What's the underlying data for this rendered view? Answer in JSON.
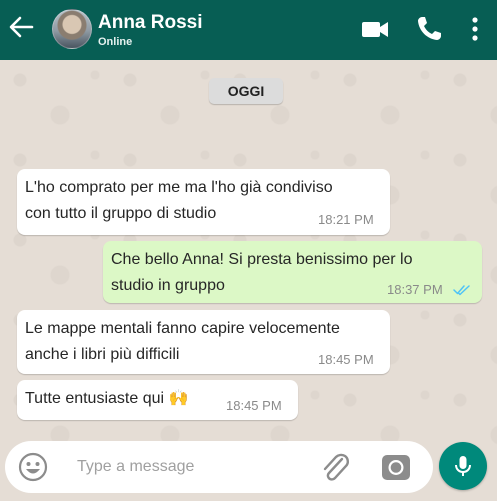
{
  "header": {
    "contact_name": "Anna Rossi",
    "status": "Online",
    "icons": [
      "back-arrow-icon",
      "video-call-icon",
      "phone-icon",
      "more-vertical-icon"
    ],
    "color": "#075e54"
  },
  "chat": {
    "date_label": "OGGI",
    "messages": [
      {
        "direction": "incoming",
        "lines": [
          "L'ho comprato per me ma l'ho già condiviso",
          "con tutto il gruppo di studio"
        ],
        "time": "18:21 PM"
      },
      {
        "direction": "outgoing",
        "lines": [
          "Che bello Anna! Si presta benissimo per lo",
          "studio in gruppo"
        ],
        "time": "18:37 PM",
        "read": true
      },
      {
        "direction": "incoming",
        "lines": [
          "Le mappe mentali fanno capire velocemente",
          "anche i libri più difficili"
        ],
        "time": "18:45 PM"
      },
      {
        "direction": "incoming",
        "lines": [
          "Tutte entusiaste qui 🙌"
        ],
        "time": "18:45 PM"
      }
    ]
  },
  "input": {
    "placeholder": "Type a message",
    "icons": [
      "emoji-icon",
      "attach-icon",
      "camera-icon",
      "mic-icon"
    ]
  },
  "colors": {
    "incoming_bubble": "#ffffff",
    "outgoing_bubble": "#dcf8c6",
    "chat_background": "#e5ddd5",
    "accent": "#00897b",
    "read_ticks": "#4fc3f7"
  }
}
